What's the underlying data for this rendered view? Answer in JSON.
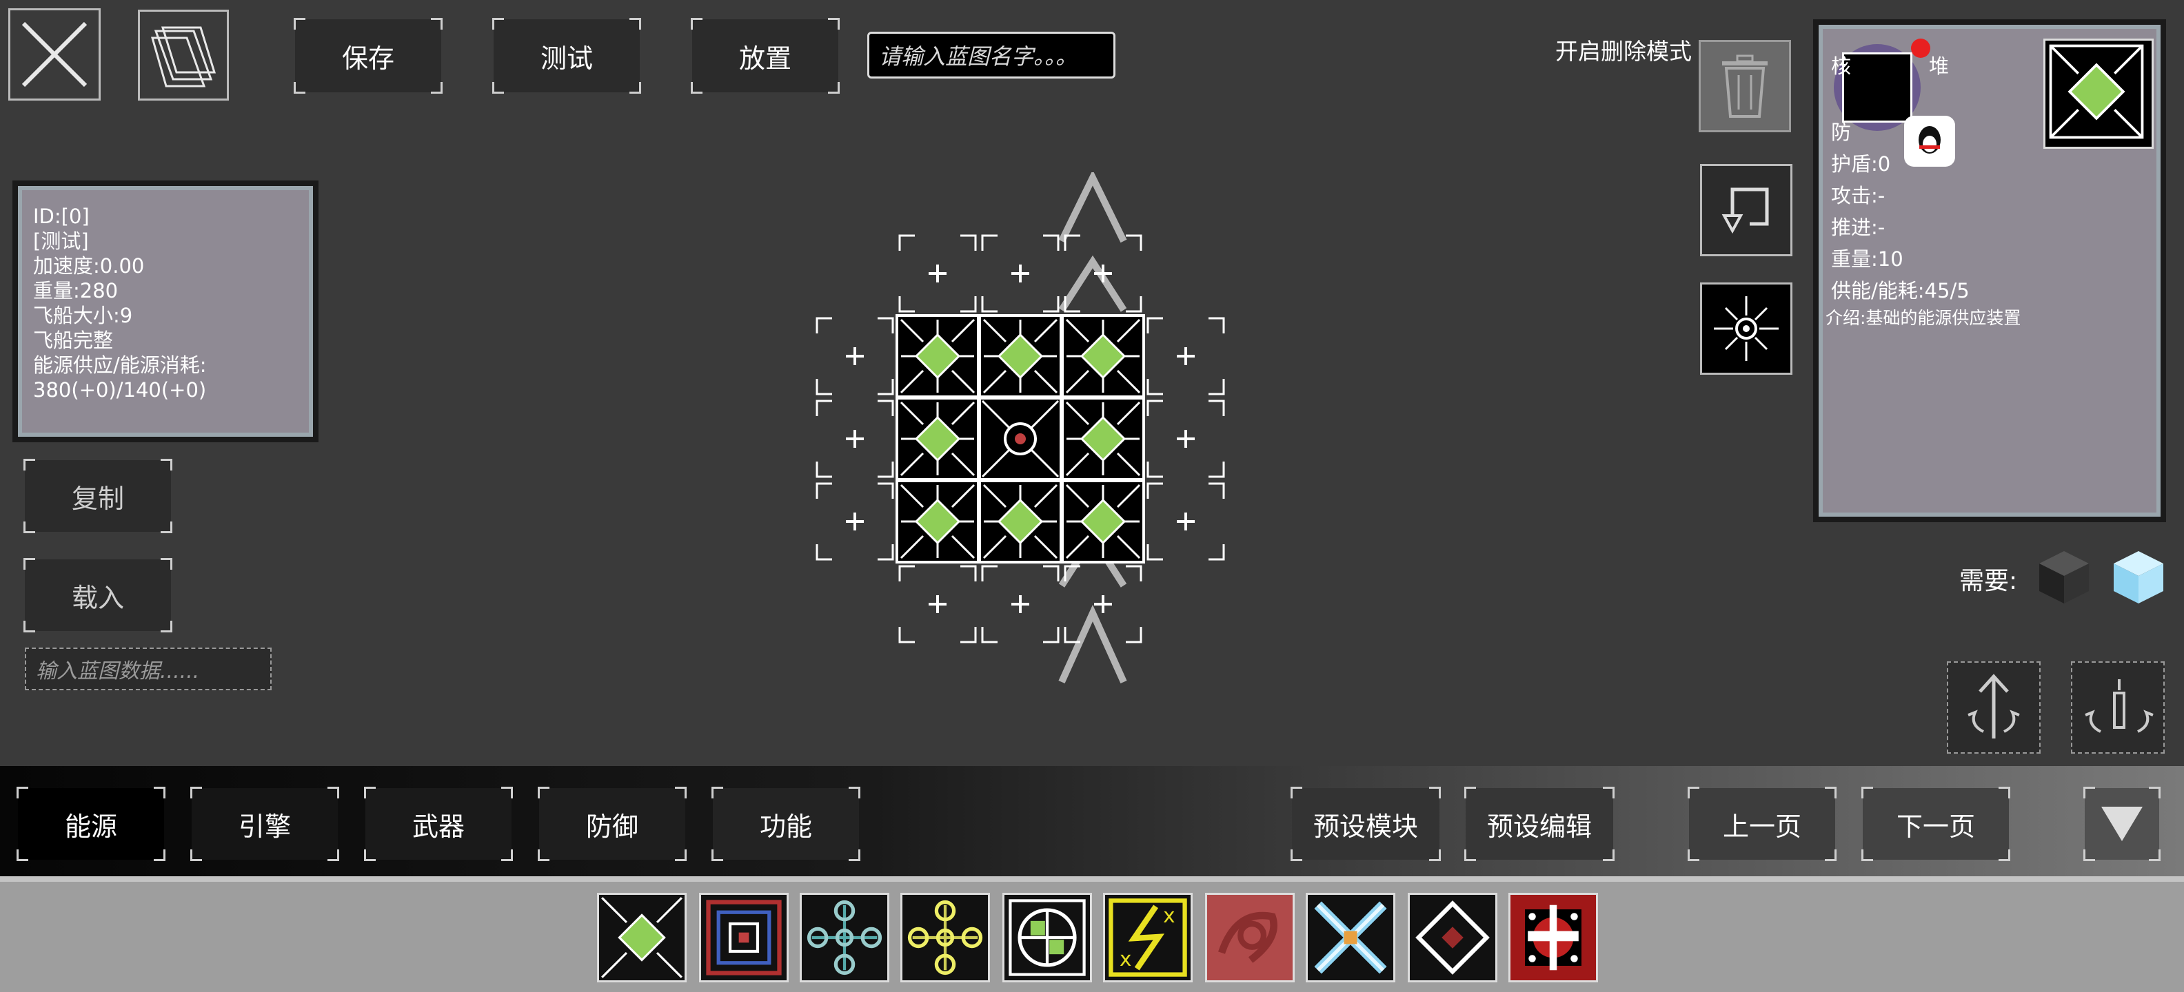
{
  "toolbar": {
    "save_label": "保存",
    "test_label": "测试",
    "place_label": "放置",
    "name_placeholder": "请输入蓝图名字。。。"
  },
  "delete_mode_label": "开启删除模式",
  "ship_info": {
    "id": "ID:[0]",
    "name": "[测试]",
    "acceleration": "加速度:0.00",
    "weight": "重量:280",
    "size": "飞船大小:9",
    "status": "飞船完整",
    "energy_label": "能源供应/能源消耗:",
    "energy_value": "380(+0)/140(+0)"
  },
  "left_actions": {
    "copy_label": "复制",
    "load_label": "载入",
    "data_placeholder": "输入蓝图数据......"
  },
  "module_info": {
    "name_left": "核",
    "name_right": "堆",
    "defense_prefix": "防",
    "shield": "护盾:0",
    "attack": "攻击:-",
    "thrust": "推进:-",
    "weight": "重量:10",
    "power": "供能/能耗:45/5",
    "description": "介绍:基础的能源供应装置"
  },
  "requires_label": "需要:",
  "categories": [
    "能源",
    "引擎",
    "武器",
    "防御",
    "功能"
  ],
  "preset": {
    "module_label": "预设模块",
    "edit_label": "预设编辑"
  },
  "paging": {
    "prev_label": "上一页",
    "next_label": "下一页"
  },
  "palette_icons": [
    "energy-core-icon",
    "red-blue-frame-icon",
    "quad-node-icon",
    "yellow-node-icon",
    "targeting-core-icon",
    "lightning-icon",
    "red-plate-icon",
    "cross-blade-icon",
    "diamond-armor-icon",
    "red-turret-icon"
  ],
  "colors": {
    "accent_green": "#8fce57",
    "background": "#3a3a3a",
    "panel": "#8f8a94"
  }
}
